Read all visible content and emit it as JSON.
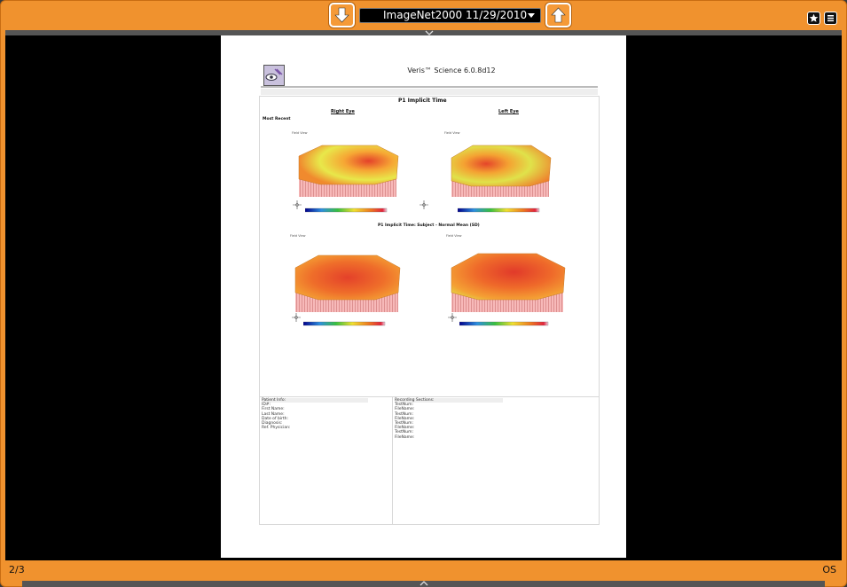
{
  "toolbar": {
    "study_label": "ImageNet2000  11/29/2010",
    "prev_icon": "arrow-down-icon",
    "next_icon": "arrow-up-icon",
    "favorite_icon": "star-icon",
    "menu_icon": "menu-icon"
  },
  "status": {
    "page_indicator": "2/3",
    "eye": "OS"
  },
  "document": {
    "software": "Veris™ Science 6.0.8d12",
    "section_title": "P1 Implicit Time",
    "right_eye_label": "Right Eye",
    "left_eye_label": "Left Eye",
    "most_recent_label": "Most Recent",
    "plot_caption": "Field View",
    "difference_title": "P1 Implicit Time: Subject - Normal Mean (SD)",
    "patient_info_label": "Patient Info:",
    "patient_fields": [
      "ID#:",
      "First Name:",
      "Last Name:",
      "Date of birth:",
      "Diagnosis:",
      "Ref. Physician:"
    ],
    "recording_label": "Recording Sections:",
    "recording_fields": [
      "TestNum:",
      "FileName:",
      "TestNum:",
      "FileName:",
      "TestNum:",
      "FileName:",
      "TestNum:",
      "FileName:"
    ]
  },
  "colors": {
    "frame": "#f0922e",
    "viewer_background": "#000000",
    "page": "#ffffff"
  }
}
